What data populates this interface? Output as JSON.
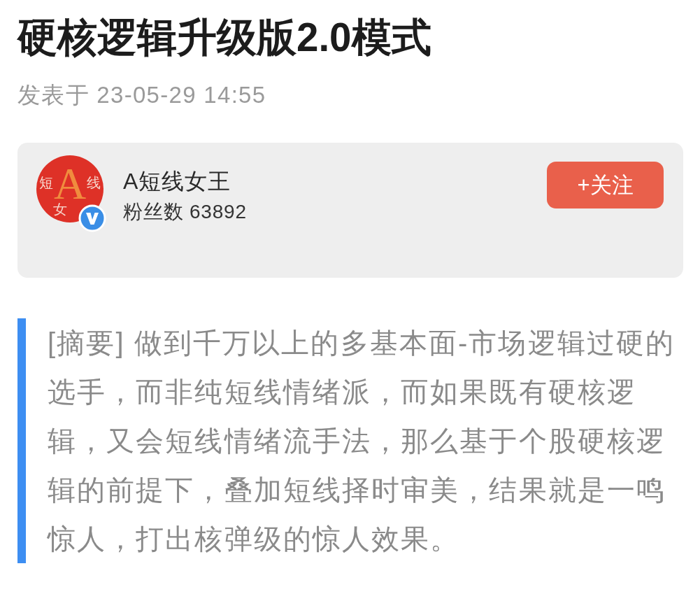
{
  "article": {
    "title": "硬核逻辑升级版2.0模式",
    "published": "发表于 23-05-29 14:55"
  },
  "author_card": {
    "avatar": {
      "letter": "A",
      "chars": [
        "短",
        "线",
        "女"
      ],
      "verified": true
    },
    "name": "A短线女王",
    "followers": "粉丝数 63892",
    "follow_button": "+关注"
  },
  "summary": {
    "text": "[摘要] 做到千万以上的多基本面-市场逻辑过硬的选手，而非纯短线情绪派，而如果既有硬核逻辑，又会短线情绪流手法，那么基于个股硬核逻辑的前提下，叠加短线择时审美，结果就是一鸣惊人，打出核弹级的惊人效果。"
  }
}
